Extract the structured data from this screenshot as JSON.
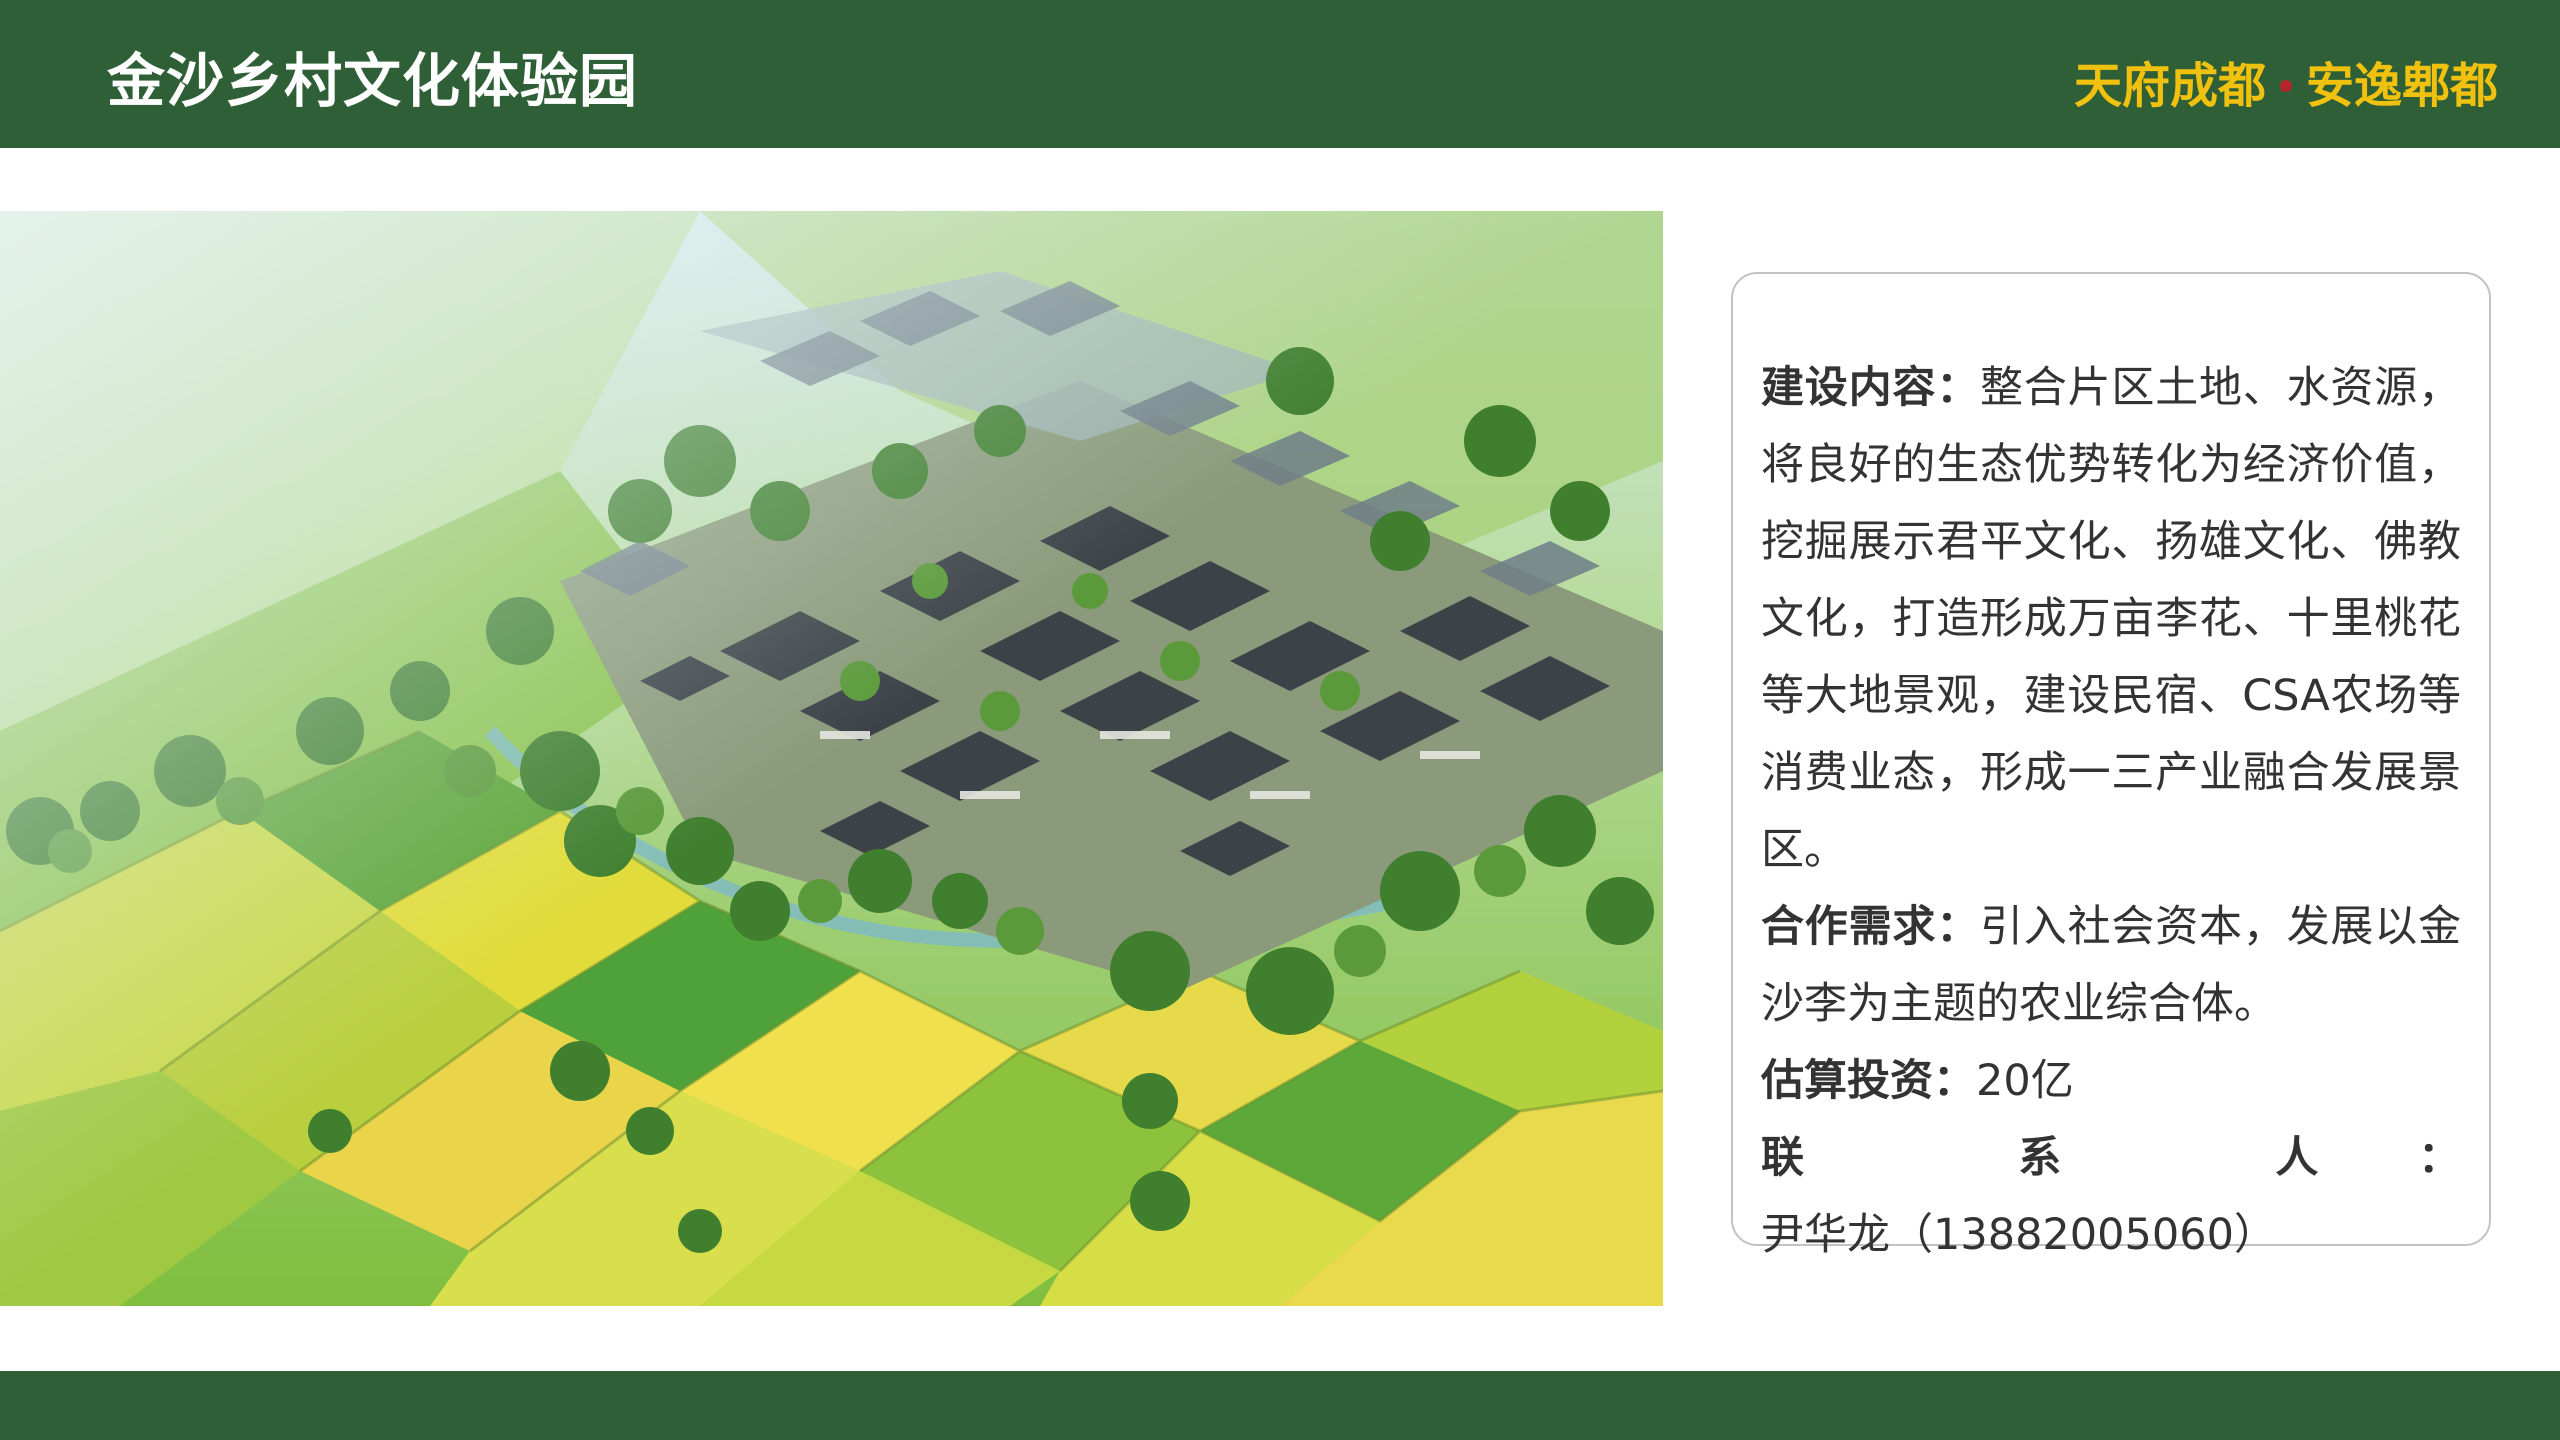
{
  "header": {
    "title": "金沙乡村文化体验园",
    "slogan_left": "天府成都",
    "slogan_right": "安逸郫都"
  },
  "image": {
    "icon": "aerial-village-rendering"
  },
  "info": {
    "construction": {
      "label": "建设内容：",
      "text": "整合片区土地、水资源，将良好的生态优势转化为经济价值，挖掘展示君平文化、扬雄文化、佛教文化，打造形成万亩李花、十里桃花等大地景观，建设民宿、CSA农场等消费业态，形成一三产业融合发展景区。"
    },
    "cooperation": {
      "label": "合作需求：",
      "text": "引入社会资本，发展以金沙李为主题的农业综合体。"
    },
    "investment": {
      "label": "估算投资：",
      "text": "20亿"
    },
    "contact": {
      "label": "联 系 人：",
      "text": "尹华龙（13882005060）"
    }
  },
  "colors": {
    "bar": "#2f5f37",
    "slogan": "#f1c10f",
    "dot": "#b5262a",
    "text": "#333333"
  }
}
